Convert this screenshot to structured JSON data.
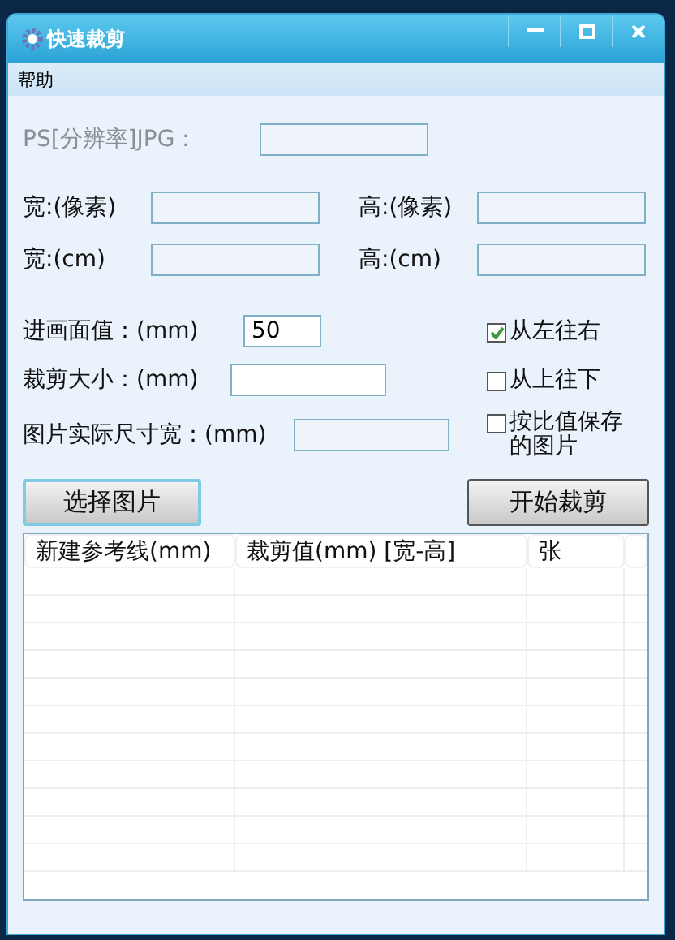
{
  "window": {
    "title": "快速裁剪"
  },
  "menu": [
    "帮助"
  ],
  "resolution_field": {
    "label": "PS[分辨率]JPG：",
    "disabled": true
  },
  "size_fields": [
    {
      "label": "宽:(像素)"
    },
    {
      "label": "高:(像素)"
    },
    {
      "label": "宽:(cm)"
    },
    {
      "label": "高:(cm)"
    }
  ],
  "crop_fields": [
    {
      "label": "进画面值：(mm)",
      "value": "50"
    },
    {
      "label": "裁剪大小：(mm)"
    },
    {
      "label": "图片实际尺寸宽：(mm)"
    }
  ],
  "options": [
    {
      "label": "从左往右",
      "checked": true
    },
    {
      "label": "从上往下",
      "checked": false
    },
    {
      "label": "按比值保存的图片",
      "checked": false
    }
  ],
  "buttons": [
    {
      "label": "选择图片",
      "focused": true
    },
    {
      "label": "开始裁剪",
      "focused": false
    }
  ],
  "table": {
    "columns": [
      "新建参考线(mm)",
      "裁剪值(mm) [宽-高]",
      "张"
    ]
  }
}
